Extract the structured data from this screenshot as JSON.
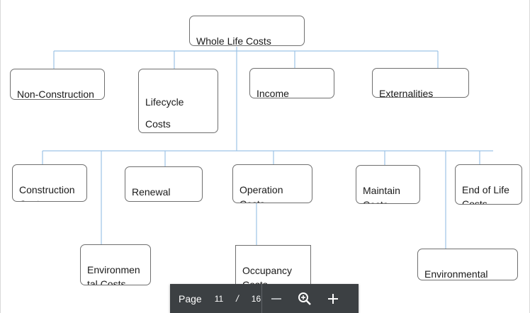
{
  "diagram": {
    "root": {
      "label": "Whole Life Costs\n(WLC)"
    },
    "level1": [
      {
        "id": "non-construction",
        "label": "Non-Construction\nCosts"
      },
      {
        "id": "lifecycle",
        "label": "Lifecycle Costs\n(LCC)"
      },
      {
        "id": "income",
        "label": "Income"
      },
      {
        "id": "externalities",
        "label": "Externalities"
      }
    ],
    "level2": [
      {
        "id": "construction",
        "label": "Construction\nCosts"
      },
      {
        "id": "renewal",
        "label": "Renewal\nCosts"
      },
      {
        "id": "operation",
        "label": "Operation\nCosts"
      },
      {
        "id": "maintain",
        "label": "Maintain\nCosts"
      },
      {
        "id": "end-of-life",
        "label": "End of Life\nCosts"
      }
    ],
    "level3": [
      {
        "id": "environmental-left",
        "label": "Environmen\ntal Costs"
      },
      {
        "id": "occupancy",
        "label": "Occupancy\nCosts"
      },
      {
        "id": "environmental-right",
        "label": "Environmental\nCosts"
      }
    ],
    "colors": {
      "connector": "#9dc3e6",
      "node_border": "#6f6f6f",
      "toolbar_bg": "#3c4043"
    }
  },
  "toolbar": {
    "page_word": "Page",
    "current_page": "11",
    "separator": "/",
    "total_pages": "16",
    "zoom_out_icon": "minus-icon",
    "zoom_fit_icon": "magnifier-plus-icon",
    "zoom_in_icon": "plus-icon"
  }
}
